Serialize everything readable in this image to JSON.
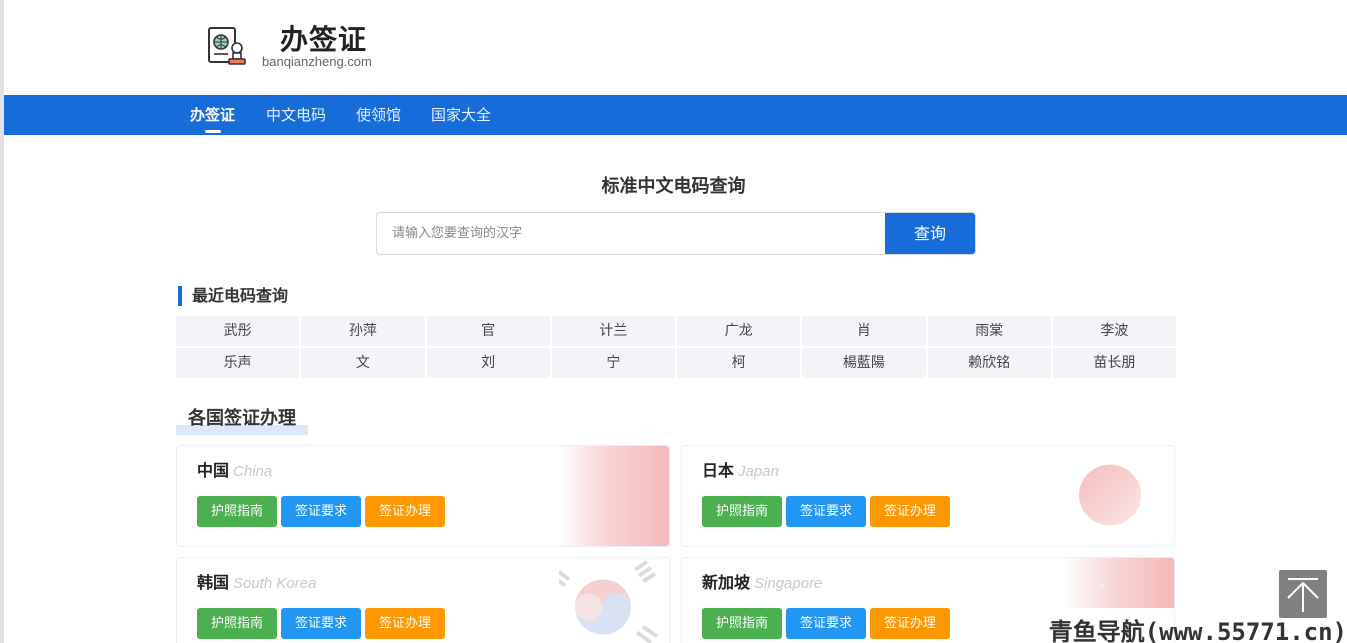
{
  "brand": {
    "title": "办签证",
    "domain": "banqianzheng.com"
  },
  "nav": [
    {
      "label": "办签证",
      "active": true
    },
    {
      "label": "中文电码",
      "active": false
    },
    {
      "label": "使领馆",
      "active": false
    },
    {
      "label": "国家大全",
      "active": false
    }
  ],
  "search": {
    "title": "标准中文电码查询",
    "placeholder": "请输入您要查询的汉字",
    "value": "",
    "button": "查询"
  },
  "recent": {
    "title": "最近电码查询",
    "items": [
      "武彤",
      "孙萍",
      "官",
      "计兰",
      "广龙",
      "肖",
      "雨棠",
      "李波",
      "乐声",
      "文",
      "刘",
      "宁",
      "柯",
      "楊藍陽",
      "赖欣铭",
      "苗长朋"
    ]
  },
  "visa": {
    "title": "各国签证办理",
    "buttons": {
      "passport": "护照指南",
      "requirements": "签证要求",
      "apply": "签证办理"
    },
    "countries": [
      {
        "name": "中国",
        "en": "China"
      },
      {
        "name": "日本",
        "en": "Japan"
      },
      {
        "name": "韩国",
        "en": "South Korea"
      },
      {
        "name": "新加坡",
        "en": "Singapore"
      }
    ]
  },
  "watermark": "青鱼导航(www.55771.cn)",
  "colors": {
    "primary": "#166dd9",
    "green": "#4caf50",
    "blue": "#2196f3",
    "orange": "#ff9800"
  }
}
